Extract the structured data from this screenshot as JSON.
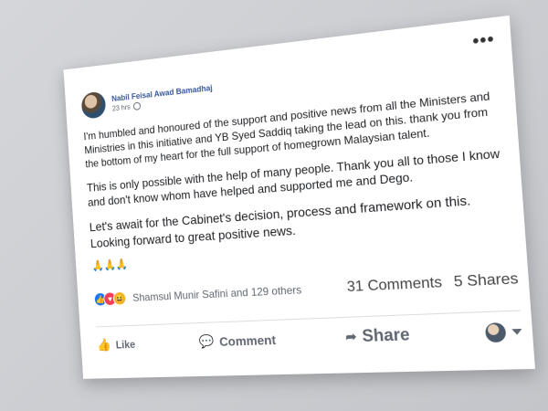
{
  "post": {
    "author": "Nabil Feisal Awad Bamadhaj",
    "time": "23 hrs",
    "paragraphs": [
      "I'm humbled and honoured of the support and positive news from all the Ministers and Ministries in this initiative and YB Syed Saddiq taking the lead on this. thank you from the bottom of my heart for the full support of homegrown Malaysian talent.",
      "This is only possible with the help of many people. Thank you all to those I know and don't know whom have helped and supported me and Dego.",
      "Let's await for the Cabinet's decision, process and framework on this. Looking forward to great positive news."
    ],
    "emoji": "🙏🙏🙏",
    "menu_icon": "•••"
  },
  "reactions": {
    "icons": [
      "like",
      "love",
      "haha"
    ],
    "names": "Shamsul Munir Safini and 129 others",
    "comments": "31 Comments",
    "shares": "5 Shares"
  },
  "actions": {
    "like": "Like",
    "comment": "Comment",
    "share": "Share"
  }
}
